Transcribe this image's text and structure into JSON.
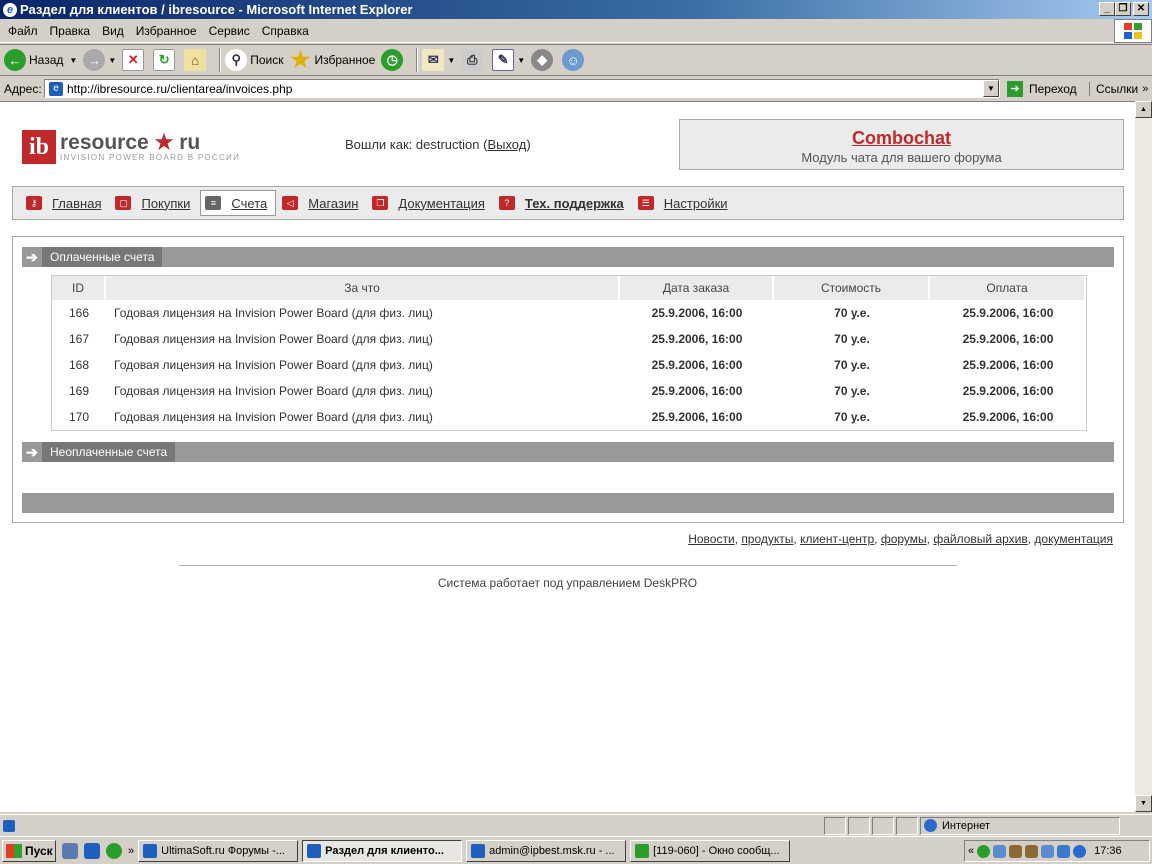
{
  "window": {
    "title": "Раздел для клиентов / ibresource - Microsoft Internet Explorer"
  },
  "menu": [
    "Файл",
    "Правка",
    "Вид",
    "Избранное",
    "Сервис",
    "Справка"
  ],
  "toolbar": {
    "back": "Назад",
    "search": "Поиск",
    "favorites": "Избранное"
  },
  "address": {
    "label": "Адрес:",
    "url": "http://ibresource.ru/clientarea/invoices.php",
    "go": "Переход",
    "links": "Ссылки"
  },
  "site": {
    "logo_text": "resource",
    "logo_tld": "ru",
    "logo_tagline": "INVISION POWER BOARD В РОССИИ",
    "login_prefix": "Вошли как: destruction (",
    "logout": "Выход",
    "login_suffix": ")",
    "promo_title": "Combochat",
    "promo_subtitle": "Модуль чата для вашего форума"
  },
  "nav": [
    {
      "label": "Главная"
    },
    {
      "label": "Покупки"
    },
    {
      "label": "Счета"
    },
    {
      "label": "Магазин"
    },
    {
      "label": "Документация"
    },
    {
      "label": "Тех. поддержка"
    },
    {
      "label": "Настройки"
    }
  ],
  "paid": {
    "title": "Оплаченные счета",
    "headers": [
      "ID",
      "За что",
      "Дата заказа",
      "Стоимость",
      "Оплата"
    ],
    "rows": [
      {
        "id": "166",
        "what": "Годовая лицензия на Invision Power Board (для физ. лиц)",
        "date": "25.9.2006, 16:00",
        "cost": "70 у.е.",
        "paid": "25.9.2006, 16:00"
      },
      {
        "id": "167",
        "what": "Годовая лицензия на Invision Power Board (для физ. лиц)",
        "date": "25.9.2006, 16:00",
        "cost": "70 у.е.",
        "paid": "25.9.2006, 16:00"
      },
      {
        "id": "168",
        "what": "Годовая лицензия на Invision Power Board (для физ. лиц)",
        "date": "25.9.2006, 16:00",
        "cost": "70 у.е.",
        "paid": "25.9.2006, 16:00"
      },
      {
        "id": "169",
        "what": "Годовая лицензия на Invision Power Board (для физ. лиц)",
        "date": "25.9.2006, 16:00",
        "cost": "70 у.е.",
        "paid": "25.9.2006, 16:00"
      },
      {
        "id": "170",
        "what": "Годовая лицензия на Invision Power Board (для физ. лиц)",
        "date": "25.9.2006, 16:00",
        "cost": "70 у.е.",
        "paid": "25.9.2006, 16:00"
      }
    ]
  },
  "unpaid": {
    "title": "Неоплаченные счета"
  },
  "footer": {
    "links": [
      "Новости",
      "продукты",
      "клиент-центр",
      "форумы",
      "файловый архив",
      "документация"
    ],
    "powered": "Система работает под управлением DeskPRO"
  },
  "status": {
    "zone": "Интернет"
  },
  "taskbar": {
    "start": "Пуск",
    "tasks": [
      "UltimaSoft.ru Форумы -...",
      "Раздел для клиенто...",
      "admin@ipbest.msk.ru - ...",
      "[119-060] - Окно сообщ..."
    ],
    "clock": "17:36"
  },
  "colors": {
    "brand": "#c0282a",
    "section_bar": "#999999",
    "titlebar": "#0a246a"
  }
}
